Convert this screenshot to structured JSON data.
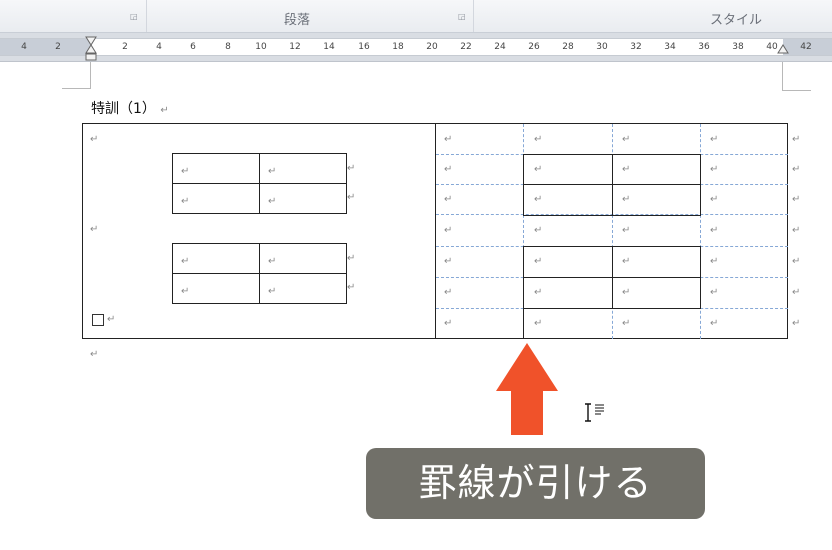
{
  "ribbon": {
    "groups": [
      {
        "label": "段落"
      },
      {
        "label": "スタイル"
      }
    ]
  },
  "ruler": {
    "left_labels": [
      "4",
      "2"
    ],
    "labels": [
      "2",
      "4",
      "6",
      "8",
      "10",
      "12",
      "14",
      "16",
      "18",
      "20",
      "22",
      "24",
      "26",
      "28",
      "30",
      "32",
      "34",
      "36",
      "38",
      "40",
      "42"
    ]
  },
  "document": {
    "heading": "特訓（1）",
    "paragraph_mark": "↵"
  },
  "caption": {
    "text": "罫線が引ける"
  },
  "colors": {
    "arrow": "#f0522a",
    "caption_bg": "#717069",
    "gridline": "#86a8d6"
  },
  "icons": {
    "arrow": "up-arrow-icon",
    "cursor": "text-cursor-icon",
    "launcher": "dialog-launcher-icon"
  }
}
